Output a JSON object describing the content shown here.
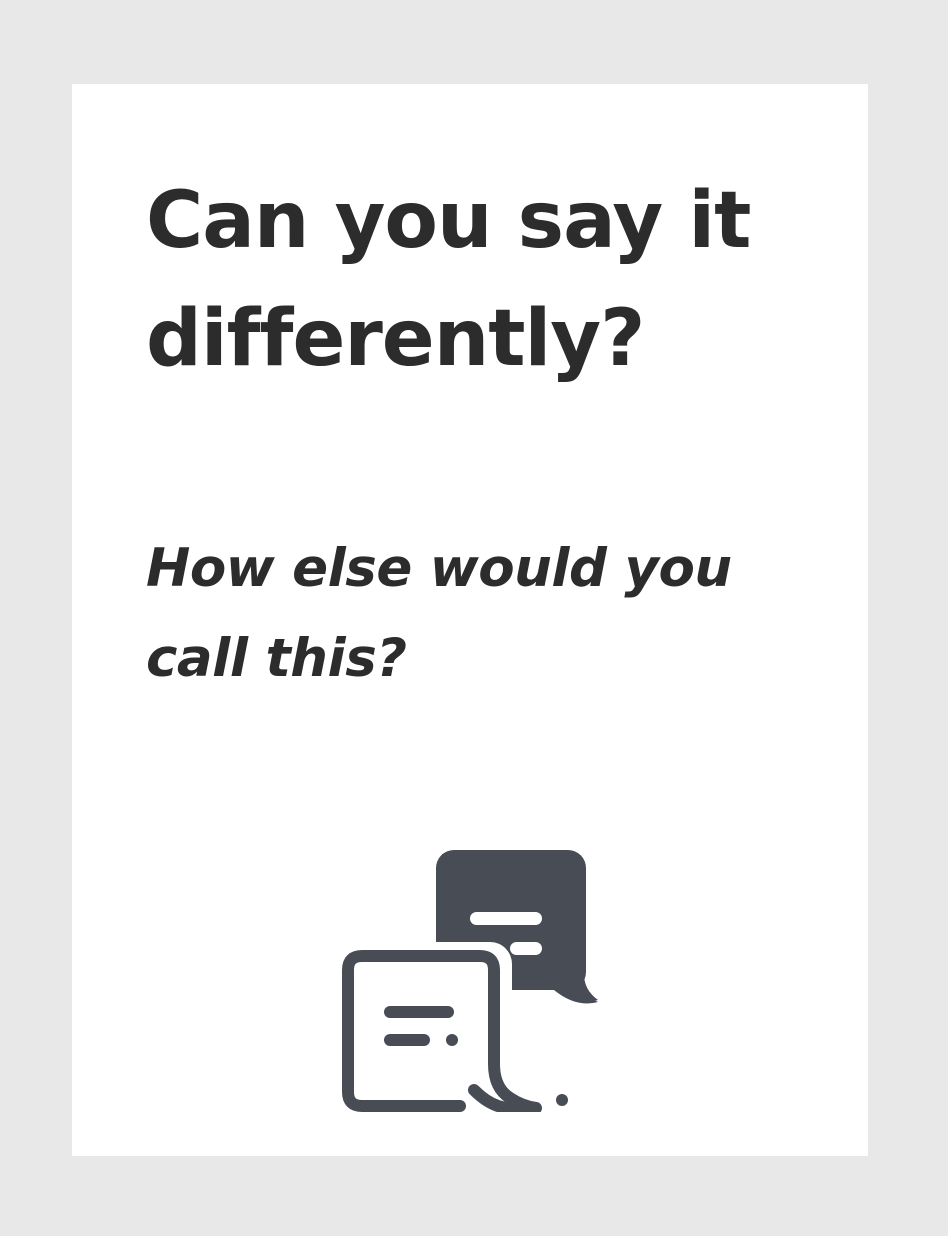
{
  "card": {
    "title": "Can you say it differently?",
    "subtitle": "How else would you call this?",
    "icon": "chat-bubbles-icon"
  },
  "colors": {
    "background": "#e8e8e8",
    "card": "#ffffff",
    "text": "#2c2c2c",
    "icon": "#474c55"
  }
}
